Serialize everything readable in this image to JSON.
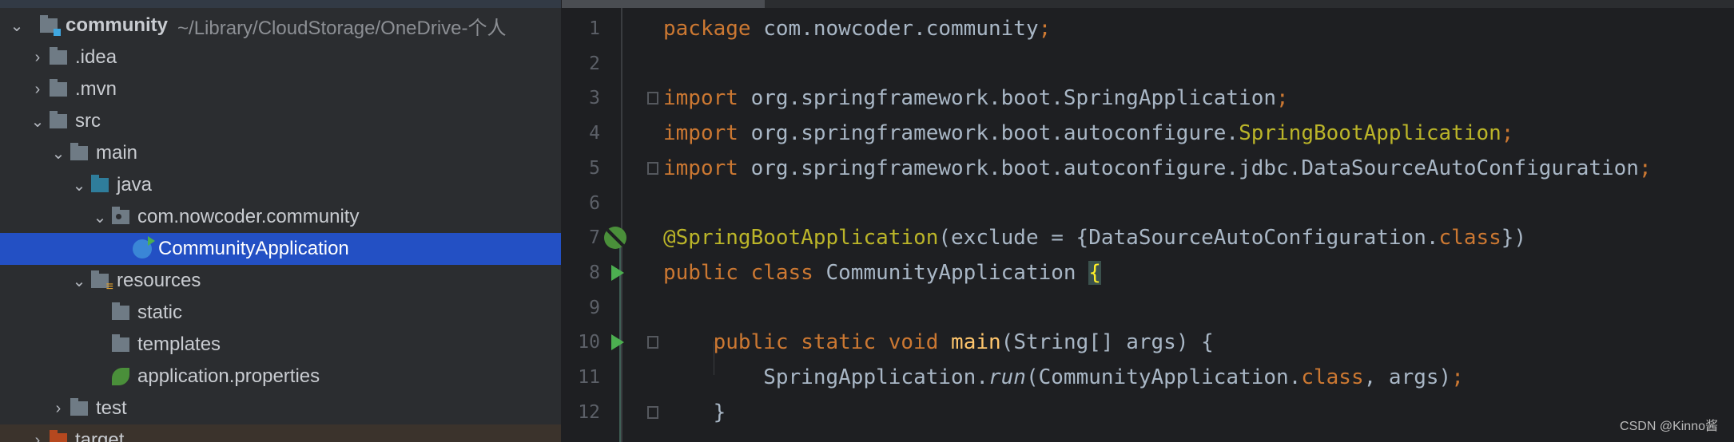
{
  "project_tree": {
    "root": {
      "name": "community",
      "path": "~/Library/CloudStorage/OneDrive-个人"
    },
    "items": [
      {
        "label": ".idea",
        "level": 1,
        "expanded": false,
        "icon": "folder-icon"
      },
      {
        "label": ".mvn",
        "level": 1,
        "expanded": false,
        "icon": "folder-icon"
      },
      {
        "label": "src",
        "level": 1,
        "expanded": true,
        "icon": "folder-icon"
      },
      {
        "label": "main",
        "level": 2,
        "expanded": true,
        "icon": "folder-icon"
      },
      {
        "label": "java",
        "level": 3,
        "expanded": true,
        "icon": "source-folder-icon"
      },
      {
        "label": "com.nowcoder.community",
        "level": 4,
        "expanded": true,
        "icon": "package-icon"
      },
      {
        "label": "CommunityApplication",
        "level": 5,
        "selected": true,
        "icon": "spring-boot-class-icon"
      },
      {
        "label": "resources",
        "level": 3,
        "expanded": true,
        "icon": "resources-folder-icon"
      },
      {
        "label": "static",
        "level": 4,
        "icon": "folder-icon"
      },
      {
        "label": "templates",
        "level": 4,
        "icon": "folder-icon"
      },
      {
        "label": "application.properties",
        "level": 4,
        "icon": "spring-properties-icon"
      },
      {
        "label": "test",
        "level": 2,
        "expanded": false,
        "icon": "folder-icon"
      },
      {
        "label": "target",
        "level": 1,
        "expanded": false,
        "icon": "excluded-folder-icon"
      }
    ]
  },
  "editor": {
    "lines": [
      {
        "n": "1",
        "tokens": [
          [
            "package",
            "kw"
          ],
          [
            " com.nowcoder.community",
            ""
          ],
          [
            ";",
            "kw"
          ]
        ]
      },
      {
        "n": "2",
        "tokens": []
      },
      {
        "n": "3",
        "tokens": [
          [
            "import",
            "kw"
          ],
          [
            " org.springframework.boot.SpringApplication",
            ""
          ],
          [
            ";",
            "kw"
          ]
        ],
        "fold": true
      },
      {
        "n": "4",
        "tokens": [
          [
            "import",
            "kw"
          ],
          [
            " org.springframework.boot.autoconfigure.",
            ""
          ],
          [
            "SpringBootApplication",
            "an"
          ],
          [
            ";",
            "kw"
          ]
        ]
      },
      {
        "n": "5",
        "tokens": [
          [
            "import",
            "kw"
          ],
          [
            " org.springframework.boot.autoconfigure.jdbc.DataSourceAutoConfiguration",
            ""
          ],
          [
            ";",
            "kw"
          ]
        ],
        "fold": true
      },
      {
        "n": "6",
        "tokens": []
      },
      {
        "n": "7",
        "tokens": [
          [
            "@SpringBootApplication",
            "an"
          ],
          [
            "(exclude = {DataSourceAutoConfiguration.",
            ""
          ],
          [
            "class",
            "kw"
          ],
          [
            "})",
            ""
          ]
        ],
        "gutter": "spring-bean-icon"
      },
      {
        "n": "8",
        "tokens": [
          [
            "public class ",
            "kw"
          ],
          [
            "CommunityApplication ",
            ""
          ],
          [
            "{",
            "br"
          ]
        ],
        "gutter": "run-icon"
      },
      {
        "n": "9",
        "tokens": []
      },
      {
        "n": "10",
        "tokens": [
          [
            "    ",
            ""
          ],
          [
            "public static void ",
            "kw"
          ],
          [
            "main",
            "fn"
          ],
          [
            "(String[] args) {",
            ""
          ]
        ],
        "gutter": "run-icon",
        "fold": true
      },
      {
        "n": "11",
        "tokens": [
          [
            "        SpringApplication.",
            ""
          ],
          [
            "run",
            "it"
          ],
          [
            "(CommunityApplication.",
            ""
          ],
          [
            "class",
            "kw"
          ],
          [
            ", args)",
            ""
          ],
          [
            ";",
            "kw"
          ]
        ]
      },
      {
        "n": "12",
        "tokens": [
          [
            "    }",
            ""
          ]
        ],
        "fold": true
      }
    ]
  },
  "watermark": "CSDN @Kinno酱",
  "colors": {
    "selection": "#2350c4",
    "keyword": "#cc7832",
    "annotation": "#bbb529",
    "method": "#ffc66d",
    "text": "#a9b7c6"
  }
}
